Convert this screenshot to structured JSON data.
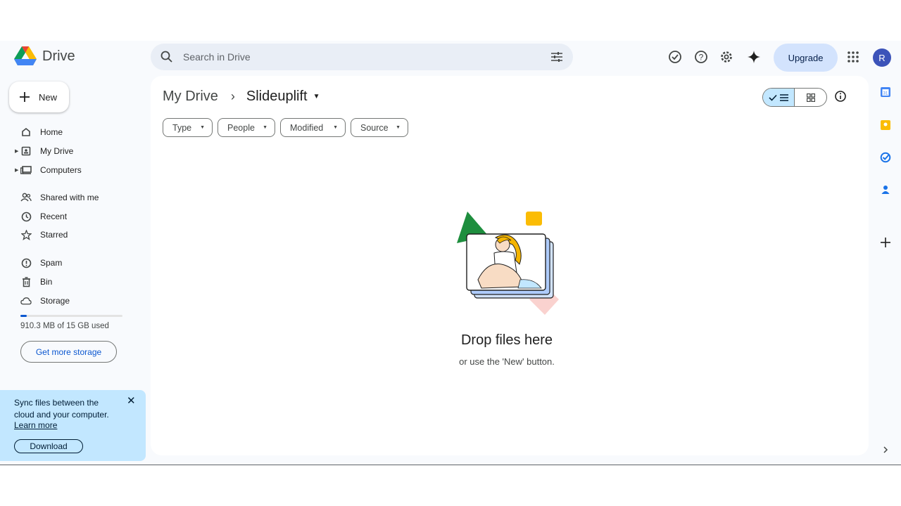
{
  "app": {
    "name": "Drive"
  },
  "search": {
    "placeholder": "Search in Drive"
  },
  "header": {
    "upgrade_label": "Upgrade",
    "avatar_initial": "R"
  },
  "sidebar": {
    "new_label": "New",
    "items": [
      {
        "label": "Home"
      },
      {
        "label": "My Drive"
      },
      {
        "label": "Computers"
      },
      {
        "label": "Shared with me"
      },
      {
        "label": "Recent"
      },
      {
        "label": "Starred"
      },
      {
        "label": "Spam"
      },
      {
        "label": "Bin"
      },
      {
        "label": "Storage"
      }
    ],
    "storage": {
      "used_text": "910.3 MB of 15 GB used",
      "used_fraction": 0.06,
      "cta": "Get more storage"
    }
  },
  "sync_banner": {
    "text": "Sync files between the cloud and your computer.",
    "link": "Learn more",
    "button": "Download"
  },
  "breadcrumb": {
    "root": "My Drive",
    "current": "Slideuplift"
  },
  "filters": [
    {
      "label": "Type"
    },
    {
      "label": "People"
    },
    {
      "label": "Modified"
    },
    {
      "label": "Source"
    }
  ],
  "empty_state": {
    "title": "Drop files here",
    "subtitle": "or use the 'New' button."
  },
  "colors": {
    "accent": "#0b57d0",
    "chip_selected": "#c2e7ff",
    "background": "#f8fafd"
  }
}
